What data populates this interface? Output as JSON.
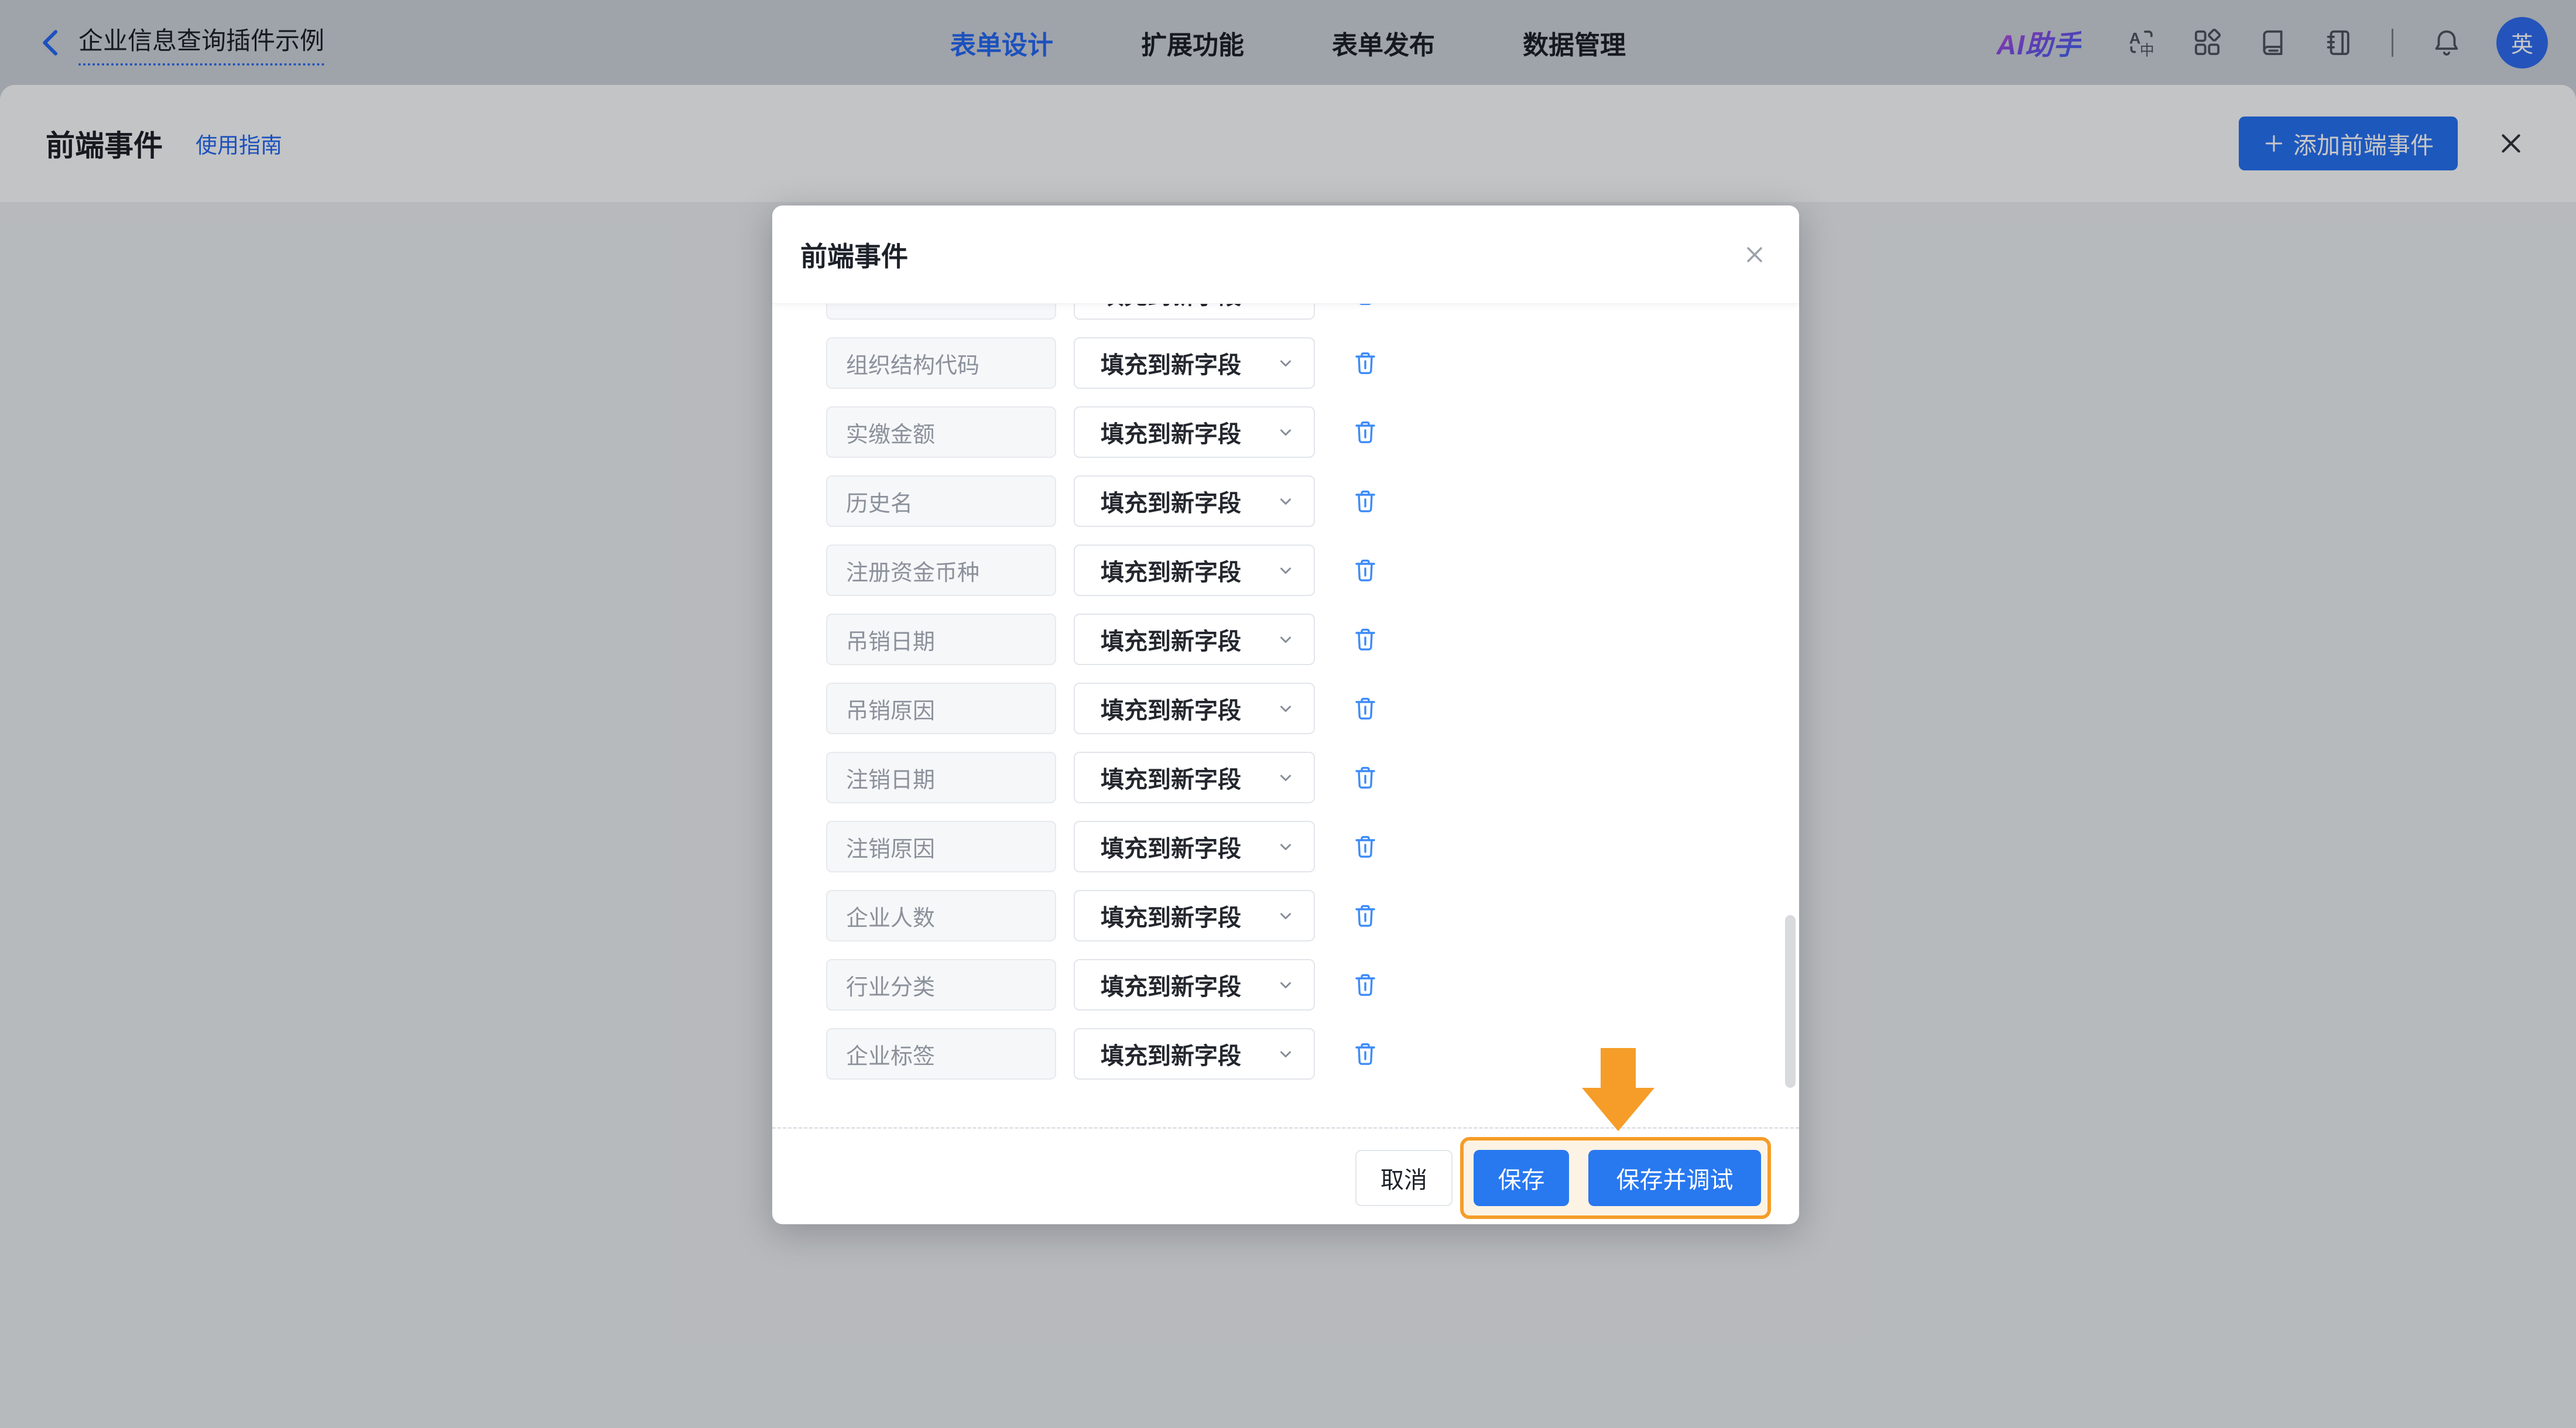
{
  "navbar": {
    "back_title": "企业信息查询插件示例",
    "tabs": [
      {
        "label": "表单设计",
        "active": true
      },
      {
        "label": "扩展功能",
        "active": false
      },
      {
        "label": "表单发布",
        "active": false
      },
      {
        "label": "数据管理",
        "active": false
      }
    ],
    "ai_assistant_label": "AI助手",
    "avatar_text": "英"
  },
  "subheader": {
    "title": "前端事件",
    "guide_link": "使用指南",
    "add_button_label": "添加前端事件"
  },
  "modal": {
    "title": "前端事件",
    "has_clipped_top_row": true,
    "action_placeholder": "填充到新字段",
    "rows": [
      {
        "field": "组织结构代码",
        "action": "填充到新字段"
      },
      {
        "field": "实缴金额",
        "action": "填充到新字段"
      },
      {
        "field": "历史名",
        "action": "填充到新字段"
      },
      {
        "field": "注册资金币种",
        "action": "填充到新字段"
      },
      {
        "field": "吊销日期",
        "action": "填充到新字段"
      },
      {
        "field": "吊销原因",
        "action": "填充到新字段"
      },
      {
        "field": "注销日期",
        "action": "填充到新字段"
      },
      {
        "field": "注销原因",
        "action": "填充到新字段"
      },
      {
        "field": "企业人数",
        "action": "填充到新字段"
      },
      {
        "field": "行业分类",
        "action": "填充到新字段"
      },
      {
        "field": "企业标签",
        "action": "填充到新字段"
      }
    ],
    "footer": {
      "cancel_label": "取消",
      "save_label": "保存",
      "save_debug_label": "保存并调试"
    }
  },
  "colors": {
    "primary_blue": "#2671f2",
    "link_blue": "#2468f2",
    "trash_blue": "#3d8bf8",
    "highlight_orange": "#f59d28",
    "navbar_bg": "#ccd1da",
    "body_bg": "#ebeef1",
    "modal_mask": "rgba(0,0,0,0.22)"
  }
}
